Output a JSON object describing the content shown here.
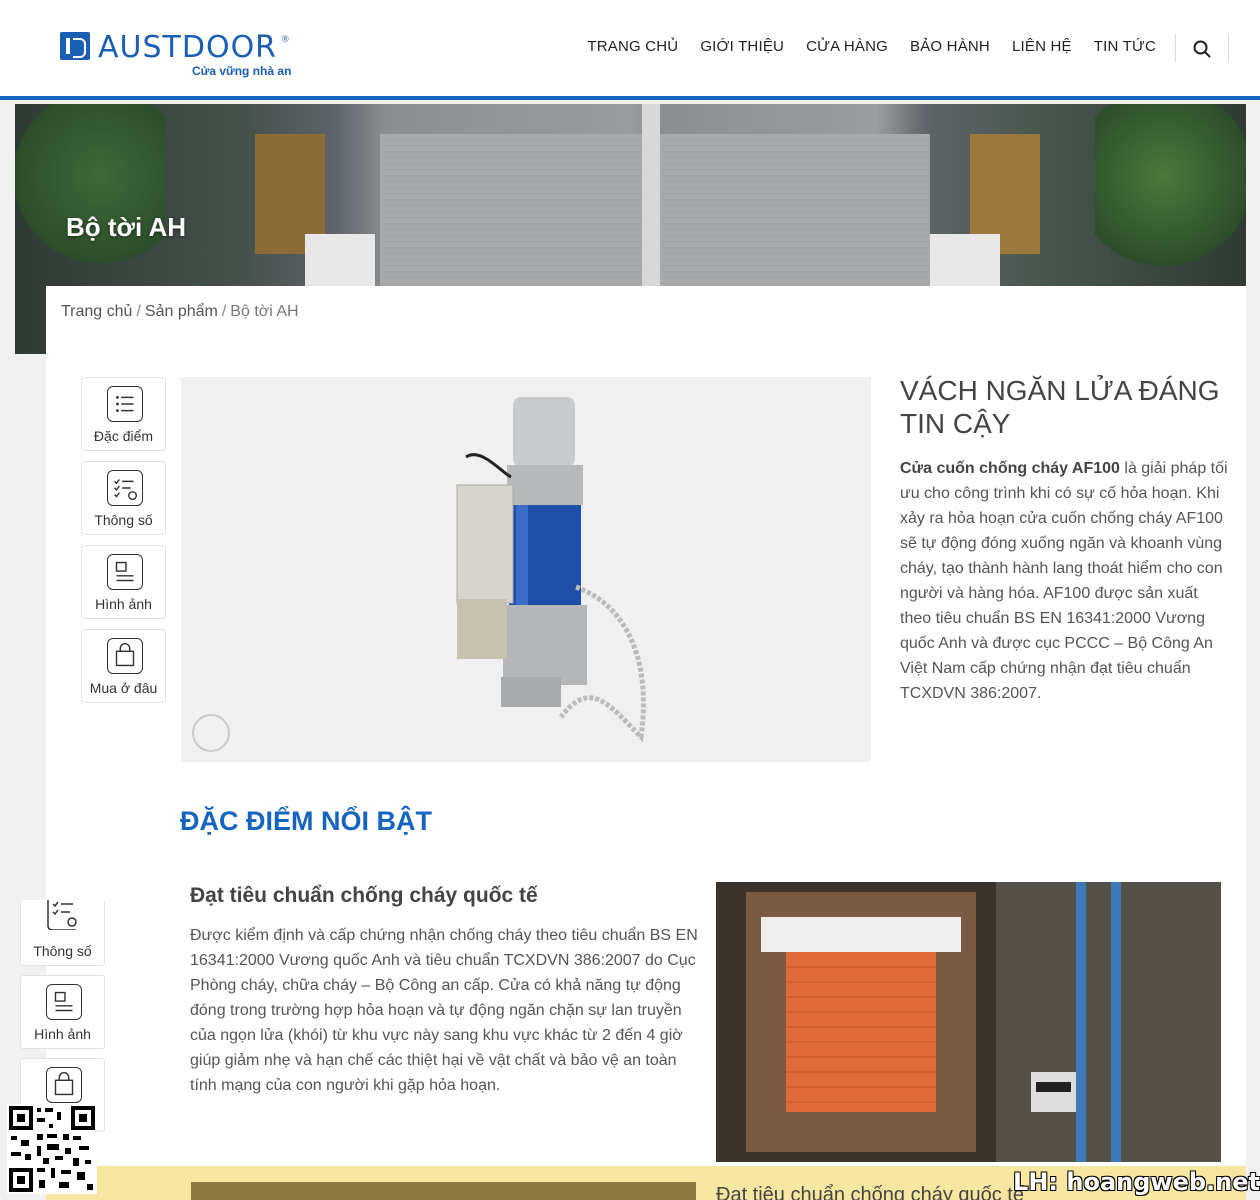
{
  "brand": {
    "name": "AUSTDOOR",
    "reg": "®",
    "tagline": "Cửa vững nhà an",
    "color": "#1a5fb4"
  },
  "nav": {
    "items": [
      "TRANG CHỦ",
      "GIỚI THIỆU",
      "CỬA HÀNG",
      "BẢO HÀNH",
      "LIÊN HỆ",
      "TIN TỨC"
    ],
    "search_icon": "search-icon"
  },
  "hero": {
    "title": "Bộ tời AH"
  },
  "breadcrumb": {
    "home": "Trang chủ",
    "products": "Sản phẩm",
    "current": "Bộ tời AH"
  },
  "sidebar": {
    "items": [
      {
        "label": "Đặc điểm",
        "icon": "list-icon"
      },
      {
        "label": "Thông số",
        "icon": "checklist-gear-icon"
      },
      {
        "label": "Hình ảnh",
        "icon": "image-doc-icon"
      },
      {
        "label": "Mua ở đâu",
        "icon": "shopping-bag-icon"
      }
    ]
  },
  "product": {
    "title": "VÁCH NGĂN LỬA ĐÁNG TIN CẬY",
    "desc_bold": "Cửa cuốn chống cháy AF100",
    "desc_rest": " là giải pháp tối ưu cho công trình khi có sự cố hỏa hoạn. Khi xảy ra hỏa hoạn cửa cuốn chống cháy AF100 sẽ tự động đóng xuống ngăn và khoanh vùng cháy, tạo thành hành lang thoát hiểm cho con người và hàng hóa. AF100 được sản xuất theo tiêu chuẩn BS EN 16341:2000 Vương quốc Anh và được cục PCCC – Bộ Công An Việt Nam cấp chứng nhận đạt tiêu chuẩn TCXDVN 386:2007."
  },
  "features": {
    "section_title": "ĐẶC ĐIỂM NỔI BẬT",
    "item1_title": "Đạt tiêu chuẩn chống cháy quốc tế",
    "item1_text": "Được kiểm định và cấp chứng nhận chống cháy theo tiêu chuẩn BS EN 16341:2000 Vương quốc Anh và tiêu chuẩn TCXDVN 386:2007 do Cục Phòng cháy, chữa cháy – Bộ Công an cấp. Cửa có khả năng tự động đóng trong trường hợp hỏa hoạn và tự động ngăn chặn sự lan truyền của ngọn lửa (khói) từ khu vực này sang khu vực khác từ 2 đến 4 giờ giúp giảm nhẹ và hạn chế các thiệt hại về vật chất và bảo vệ an toàn tính mạng của con người khi gặp hỏa hoạn.",
    "item2_title": "Đạt tiêu chuẩn chống cháy quốc tế"
  },
  "float_nav": {
    "items": [
      {
        "label": "Thông số",
        "icon": "checklist-gear-icon"
      },
      {
        "label": "Hình ảnh",
        "icon": "image-doc-icon"
      },
      {
        "label": "",
        "icon": "shopping-bag-icon"
      }
    ]
  },
  "watermark": "LH: hoangweb.net",
  "colors": {
    "accent": "#1565c0",
    "band": "#f7e7a0"
  }
}
